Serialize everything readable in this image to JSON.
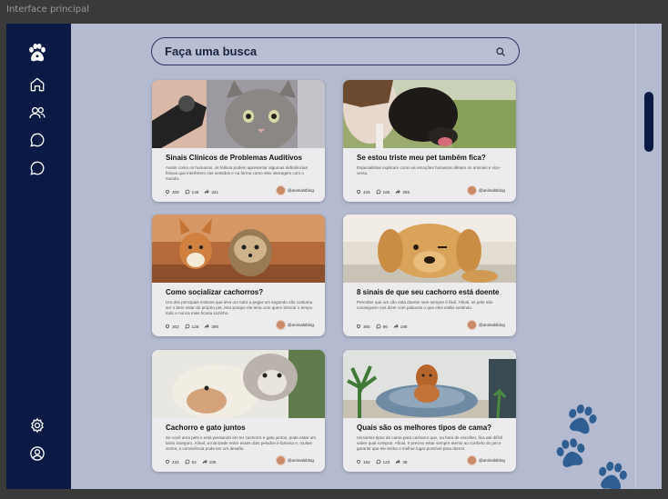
{
  "window": {
    "title": "Interface principal"
  },
  "colors": {
    "sidebar": "#0a1a45",
    "background": "#b4bacf",
    "paw": "#2f5e93"
  },
  "sidebar": {
    "top_icons": [
      "paw-logo-icon",
      "home-icon",
      "users-icon",
      "chat-icon",
      "message-icon"
    ],
    "bottom_icons": [
      "gear-icon",
      "user-profile-icon"
    ]
  },
  "search": {
    "placeholder": "Faça uma busca"
  },
  "cards": [
    {
      "title": "Sinais Clínicos de Problemas Auditivos",
      "text": "Assim como os humanos, os felinos podem apresentar algumas deficiências físicas que interferem nos sentidos e na forma como eles interagem com o mundo.",
      "likes": "309",
      "comments": "148",
      "shares": "341",
      "author": "@animalsblog"
    },
    {
      "title": "Se estou triste meu pet também fica?",
      "text": "Especialistas explicam como as emoções humanas afetam os animais e vice-versa.",
      "likes": "426",
      "comments": "160",
      "shares": "285",
      "author": "@animalsblog"
    },
    {
      "title": "Como socializar cachorros?",
      "text": "Um dos principais motivos que leva um tutor a pegar um segundo cão costuma ser o bem estar do próprio pet, isso porque ele teria com quem brincar o tempo todo e nunca mais ficaria sozinho.",
      "likes": "302",
      "comments": "126",
      "shares": "390",
      "author": "@animalsblog"
    },
    {
      "title": "8 sinais de que seu cachorro está doente",
      "text": "Perceber que um cão está doente nem sempre é fácil. Afinal, os pets não conseguem nos dizer com palavras o que eles estão sentindo.",
      "likes": "365",
      "comments": "96",
      "shares": "188",
      "author": "@animalsblog"
    },
    {
      "title": "Cachorro e gato juntos",
      "text": "Se você ama pets e está pensando em ter cachorro e gato juntos, pode estar um tanto inseguro. Afinal, a inimizade entre esses dois peludos é famosa e, muitas vezes, a convivência pode ser um desafio.",
      "likes": "234",
      "comments": "52",
      "shares": "106",
      "author": "@animalsblog"
    },
    {
      "title": "Quais são os melhores tipos de cama?",
      "text": "Há tantos tipos de cama para cachorro que, na hora de escolher, fica até difícil saber qual comprar. Afinal, é preciso estar sempre atento ao conforto do pet e garantir que ele tenha o melhor lugar possível para dormir.",
      "likes": "152",
      "comments": "123",
      "shares": "38",
      "author": "@animalsblog"
    }
  ]
}
